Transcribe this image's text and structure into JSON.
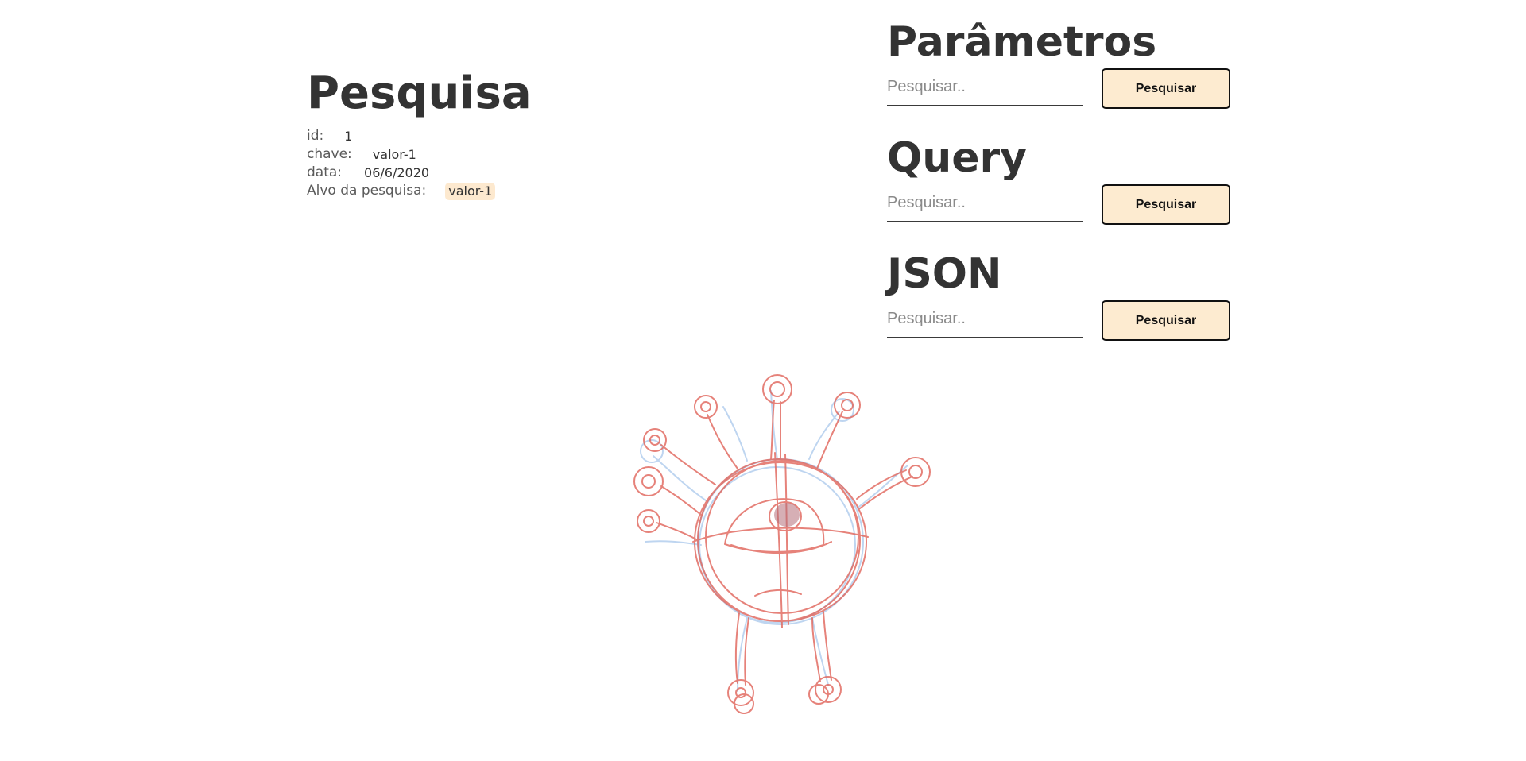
{
  "pesquisa": {
    "title": "Pesquisa",
    "fields": {
      "id_label": "id:",
      "id_value": "1",
      "chave_label": "chave:",
      "chave_value": "valor-1",
      "data_label": "data:",
      "data_value": "06/6/2020",
      "alvo_label": "Alvo da pesquisa:",
      "alvo_value": "valor-1"
    }
  },
  "forms": [
    {
      "title": "Parâmetros",
      "placeholder": "Pesquisar..",
      "button_label": "Pesquisar"
    },
    {
      "title": "Query",
      "placeholder": "Pesquisar..",
      "button_label": "Pesquisar"
    },
    {
      "title": "JSON",
      "placeholder": "Pesquisar..",
      "button_label": "Pesquisar"
    }
  ],
  "colors": {
    "tag_background": "#fde9cf",
    "button_background": "#fdebd0",
    "sketch_red": "#e0645a",
    "sketch_blue": "#a9c8ec"
  },
  "illustration": {
    "icon": "one-eyed-virus-monster-sketch"
  }
}
